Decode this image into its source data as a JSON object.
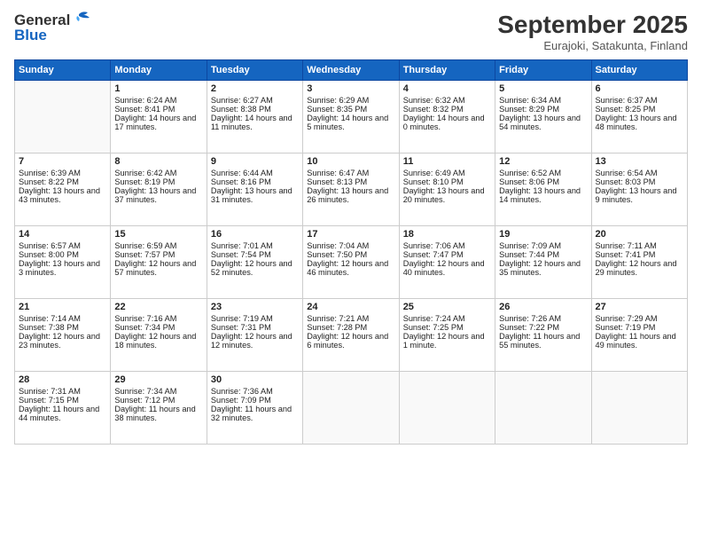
{
  "logo": {
    "line1": "General",
    "line2": "Blue"
  },
  "title": "September 2025",
  "subtitle": "Eurajoki, Satakunta, Finland",
  "weekdays": [
    "Sunday",
    "Monday",
    "Tuesday",
    "Wednesday",
    "Thursday",
    "Friday",
    "Saturday"
  ],
  "weeks": [
    [
      {
        "day": "",
        "sunrise": "",
        "sunset": "",
        "daylight": "",
        "empty": true
      },
      {
        "day": "1",
        "sunrise": "Sunrise: 6:24 AM",
        "sunset": "Sunset: 8:41 PM",
        "daylight": "Daylight: 14 hours and 17 minutes."
      },
      {
        "day": "2",
        "sunrise": "Sunrise: 6:27 AM",
        "sunset": "Sunset: 8:38 PM",
        "daylight": "Daylight: 14 hours and 11 minutes."
      },
      {
        "day": "3",
        "sunrise": "Sunrise: 6:29 AM",
        "sunset": "Sunset: 8:35 PM",
        "daylight": "Daylight: 14 hours and 5 minutes."
      },
      {
        "day": "4",
        "sunrise": "Sunrise: 6:32 AM",
        "sunset": "Sunset: 8:32 PM",
        "daylight": "Daylight: 14 hours and 0 minutes."
      },
      {
        "day": "5",
        "sunrise": "Sunrise: 6:34 AM",
        "sunset": "Sunset: 8:29 PM",
        "daylight": "Daylight: 13 hours and 54 minutes."
      },
      {
        "day": "6",
        "sunrise": "Sunrise: 6:37 AM",
        "sunset": "Sunset: 8:25 PM",
        "daylight": "Daylight: 13 hours and 48 minutes."
      }
    ],
    [
      {
        "day": "7",
        "sunrise": "Sunrise: 6:39 AM",
        "sunset": "Sunset: 8:22 PM",
        "daylight": "Daylight: 13 hours and 43 minutes."
      },
      {
        "day": "8",
        "sunrise": "Sunrise: 6:42 AM",
        "sunset": "Sunset: 8:19 PM",
        "daylight": "Daylight: 13 hours and 37 minutes."
      },
      {
        "day": "9",
        "sunrise": "Sunrise: 6:44 AM",
        "sunset": "Sunset: 8:16 PM",
        "daylight": "Daylight: 13 hours and 31 minutes."
      },
      {
        "day": "10",
        "sunrise": "Sunrise: 6:47 AM",
        "sunset": "Sunset: 8:13 PM",
        "daylight": "Daylight: 13 hours and 26 minutes."
      },
      {
        "day": "11",
        "sunrise": "Sunrise: 6:49 AM",
        "sunset": "Sunset: 8:10 PM",
        "daylight": "Daylight: 13 hours and 20 minutes."
      },
      {
        "day": "12",
        "sunrise": "Sunrise: 6:52 AM",
        "sunset": "Sunset: 8:06 PM",
        "daylight": "Daylight: 13 hours and 14 minutes."
      },
      {
        "day": "13",
        "sunrise": "Sunrise: 6:54 AM",
        "sunset": "Sunset: 8:03 PM",
        "daylight": "Daylight: 13 hours and 9 minutes."
      }
    ],
    [
      {
        "day": "14",
        "sunrise": "Sunrise: 6:57 AM",
        "sunset": "Sunset: 8:00 PM",
        "daylight": "Daylight: 13 hours and 3 minutes."
      },
      {
        "day": "15",
        "sunrise": "Sunrise: 6:59 AM",
        "sunset": "Sunset: 7:57 PM",
        "daylight": "Daylight: 12 hours and 57 minutes."
      },
      {
        "day": "16",
        "sunrise": "Sunrise: 7:01 AM",
        "sunset": "Sunset: 7:54 PM",
        "daylight": "Daylight: 12 hours and 52 minutes."
      },
      {
        "day": "17",
        "sunrise": "Sunrise: 7:04 AM",
        "sunset": "Sunset: 7:50 PM",
        "daylight": "Daylight: 12 hours and 46 minutes."
      },
      {
        "day": "18",
        "sunrise": "Sunrise: 7:06 AM",
        "sunset": "Sunset: 7:47 PM",
        "daylight": "Daylight: 12 hours and 40 minutes."
      },
      {
        "day": "19",
        "sunrise": "Sunrise: 7:09 AM",
        "sunset": "Sunset: 7:44 PM",
        "daylight": "Daylight: 12 hours and 35 minutes."
      },
      {
        "day": "20",
        "sunrise": "Sunrise: 7:11 AM",
        "sunset": "Sunset: 7:41 PM",
        "daylight": "Daylight: 12 hours and 29 minutes."
      }
    ],
    [
      {
        "day": "21",
        "sunrise": "Sunrise: 7:14 AM",
        "sunset": "Sunset: 7:38 PM",
        "daylight": "Daylight: 12 hours and 23 minutes."
      },
      {
        "day": "22",
        "sunrise": "Sunrise: 7:16 AM",
        "sunset": "Sunset: 7:34 PM",
        "daylight": "Daylight: 12 hours and 18 minutes."
      },
      {
        "day": "23",
        "sunrise": "Sunrise: 7:19 AM",
        "sunset": "Sunset: 7:31 PM",
        "daylight": "Daylight: 12 hours and 12 minutes."
      },
      {
        "day": "24",
        "sunrise": "Sunrise: 7:21 AM",
        "sunset": "Sunset: 7:28 PM",
        "daylight": "Daylight: 12 hours and 6 minutes."
      },
      {
        "day": "25",
        "sunrise": "Sunrise: 7:24 AM",
        "sunset": "Sunset: 7:25 PM",
        "daylight": "Daylight: 12 hours and 1 minute."
      },
      {
        "day": "26",
        "sunrise": "Sunrise: 7:26 AM",
        "sunset": "Sunset: 7:22 PM",
        "daylight": "Daylight: 11 hours and 55 minutes."
      },
      {
        "day": "27",
        "sunrise": "Sunrise: 7:29 AM",
        "sunset": "Sunset: 7:19 PM",
        "daylight": "Daylight: 11 hours and 49 minutes."
      }
    ],
    [
      {
        "day": "28",
        "sunrise": "Sunrise: 7:31 AM",
        "sunset": "Sunset: 7:15 PM",
        "daylight": "Daylight: 11 hours and 44 minutes."
      },
      {
        "day": "29",
        "sunrise": "Sunrise: 7:34 AM",
        "sunset": "Sunset: 7:12 PM",
        "daylight": "Daylight: 11 hours and 38 minutes."
      },
      {
        "day": "30",
        "sunrise": "Sunrise: 7:36 AM",
        "sunset": "Sunset: 7:09 PM",
        "daylight": "Daylight: 11 hours and 32 minutes."
      },
      {
        "day": "",
        "sunrise": "",
        "sunset": "",
        "daylight": "",
        "empty": true
      },
      {
        "day": "",
        "sunrise": "",
        "sunset": "",
        "daylight": "",
        "empty": true
      },
      {
        "day": "",
        "sunrise": "",
        "sunset": "",
        "daylight": "",
        "empty": true
      },
      {
        "day": "",
        "sunrise": "",
        "sunset": "",
        "daylight": "",
        "empty": true
      }
    ]
  ]
}
